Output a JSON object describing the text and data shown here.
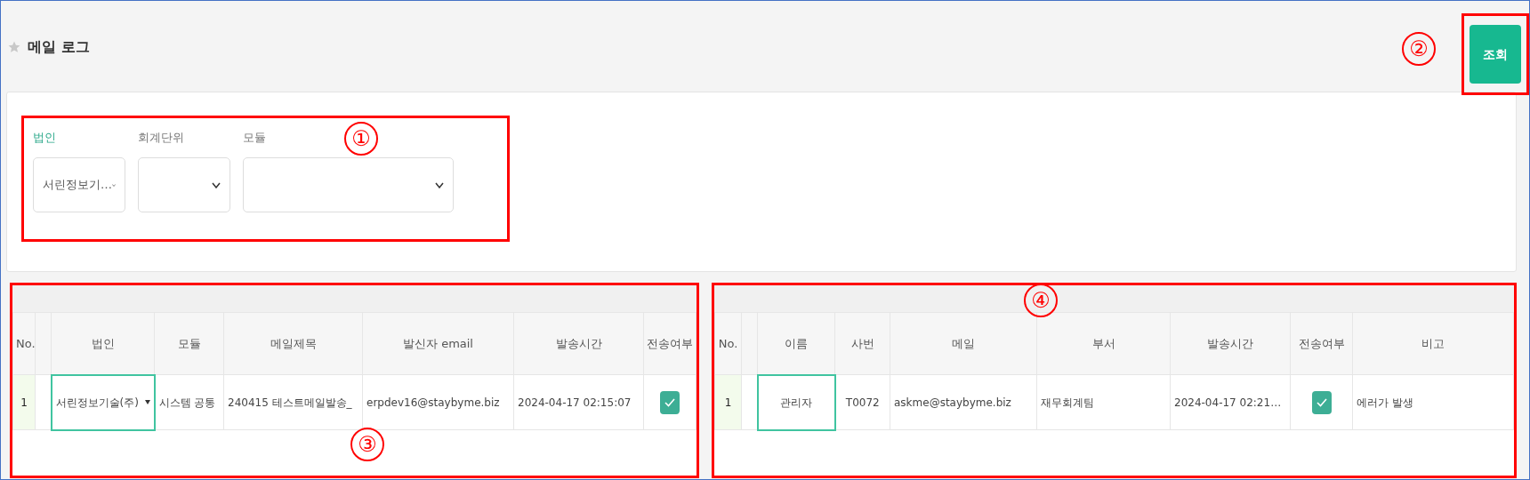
{
  "page": {
    "title": "메일 로그"
  },
  "search_button": {
    "label": "조회",
    "annotation": "②"
  },
  "filters": {
    "annotation": "①",
    "fields": [
      {
        "label": "법인",
        "required": true,
        "value": "서린정보기…"
      },
      {
        "label": "회계단위",
        "required": false
      },
      {
        "label": "모듈",
        "required": false
      }
    ]
  },
  "tables": [
    {
      "annotation": "③",
      "columns": [
        "No.",
        "",
        "법인",
        "모듈",
        "메일제목",
        "발신자 email",
        "발송시간",
        "전송여부"
      ],
      "rows": [
        {
          "cells": [
            {
              "kind": "number",
              "text": "1"
            },
            {
              "kind": "blank"
            },
            {
              "kind": "select",
              "text": "서린정보기술(주)"
            },
            {
              "kind": "text",
              "text": "시스템 공통"
            },
            {
              "kind": "text",
              "text": "240415 테스트메일발송_"
            },
            {
              "kind": "text",
              "text": "erpdev16@staybyme.biz"
            },
            {
              "kind": "text",
              "text": "2024-04-17 02:15:07"
            },
            {
              "kind": "check",
              "checked": true
            }
          ]
        }
      ]
    },
    {
      "annotation": "④",
      "columns": [
        "No.",
        "",
        "이름",
        "사번",
        "메일",
        "부서",
        "발송시간",
        "전송여부",
        "비고"
      ],
      "rows": [
        {
          "cells": [
            {
              "kind": "number",
              "text": "1"
            },
            {
              "kind": "blank"
            },
            {
              "kind": "edit",
              "text": "관리자"
            },
            {
              "kind": "center",
              "text": "T0072"
            },
            {
              "kind": "text",
              "text": "askme@staybyme.biz"
            },
            {
              "kind": "text",
              "text": "재무회계팀"
            },
            {
              "kind": "text",
              "text": "2024-04-17 02:21…"
            },
            {
              "kind": "check",
              "checked": true
            },
            {
              "kind": "text",
              "text": "에러가 발생"
            }
          ]
        }
      ]
    }
  ]
}
